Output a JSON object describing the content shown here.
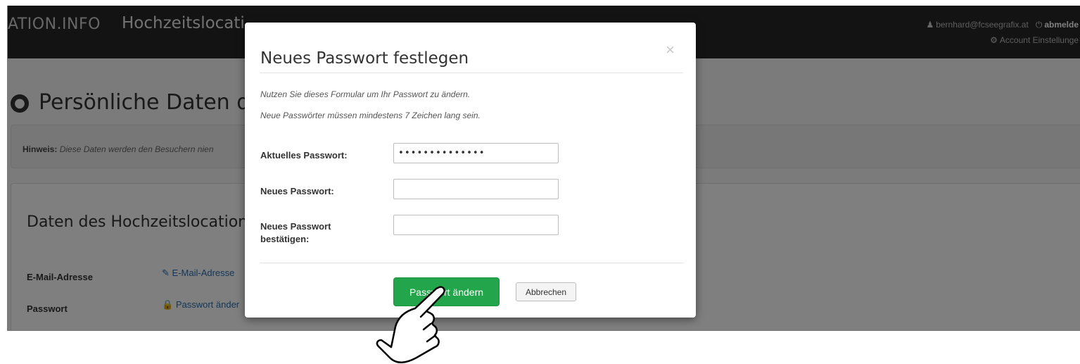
{
  "navbar": {
    "brand": "ATION.INFO",
    "brand_sub": "Hochzeitslocati",
    "user_email": "bernhard@fcseegrafix.at",
    "logout": "abmelde",
    "account_settings": "Account Einstellunge",
    "user_icon": "user-icon",
    "power_icon": "power-icon",
    "gear_icon": "gear-icon"
  },
  "page": {
    "heading": "Persönliche Daten d",
    "heading_icon": "globe-icon",
    "hint_label": "Hinweis:",
    "hint_text": "Diese Daten werden den Besuchern nien",
    "data_title": "Daten des Hochzeitslocation",
    "rows": [
      {
        "label": "E-Mail-Adresse",
        "link": "E-Mail-Adresse",
        "icon": "pencil-icon"
      },
      {
        "label": "Passwort",
        "link": "Passwort änder",
        "icon": "lock-icon"
      }
    ]
  },
  "modal": {
    "title": "Neues Passwort festlegen",
    "close_symbol": "×",
    "info_1": "Nutzen Sie dieses Formular um Ihr Passwort zu ändern.",
    "info_2": "Neue Passwörter müssen mindestens 7 Zeichen lang sein.",
    "fields": [
      {
        "label": "Aktuelles Passwort:",
        "value": "••••••••••••••"
      },
      {
        "label": "Neues Passwort:",
        "value": ""
      },
      {
        "label": "Neues Passwort bestätigen:",
        "value": ""
      }
    ],
    "submit_label": "Passwort ändern",
    "cancel_label": "Abbrechen"
  },
  "colors": {
    "navbar_bg": "#262626",
    "primary_green": "#23a64b",
    "link_blue": "#2a6db0",
    "backdrop": "rgba(0,0,0,0.5)"
  },
  "cursor_icon": "hand-pointer-icon"
}
